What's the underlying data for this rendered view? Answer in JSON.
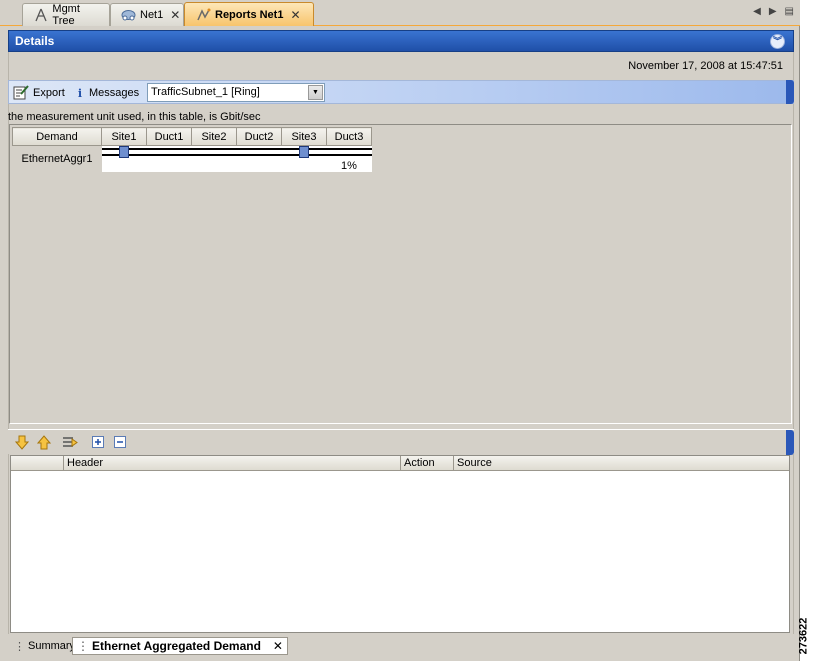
{
  "tabs": [
    {
      "label": "Mgmt Tree",
      "icon": "tree-icon"
    },
    {
      "label": "Net1",
      "icon": "network-icon"
    },
    {
      "label": "Reports Net1",
      "icon": "report-icon",
      "active": true
    }
  ],
  "details": {
    "title": "Details"
  },
  "timestamp": "November 17, 2008 at 15:47:51",
  "toolbar": {
    "export_label": "Export",
    "messages_label": "Messages",
    "select_value": "TrafficSubnet_1 [Ring]"
  },
  "unit_note": "the measurement unit used, in this table, is  Gbit/sec",
  "demand_table": {
    "headers": [
      "Demand",
      "Site1",
      "Duct1",
      "Site2",
      "Duct2",
      "Site3",
      "Duct3"
    ],
    "rows": [
      {
        "name": "EthernetAggr1",
        "site1_marker": true,
        "site3_marker": true,
        "duct3_value": "1%"
      }
    ]
  },
  "lower_table": {
    "headers": [
      "",
      "Header",
      "Action",
      "Source"
    ]
  },
  "bottom_tabs": [
    {
      "label": "Summary"
    },
    {
      "label": "Ethernet Aggregated Demand",
      "active": true
    }
  ],
  "figure_id": "273622",
  "colors": {
    "accent": "#1f4fa8",
    "tab_active": "#f7c46c"
  }
}
